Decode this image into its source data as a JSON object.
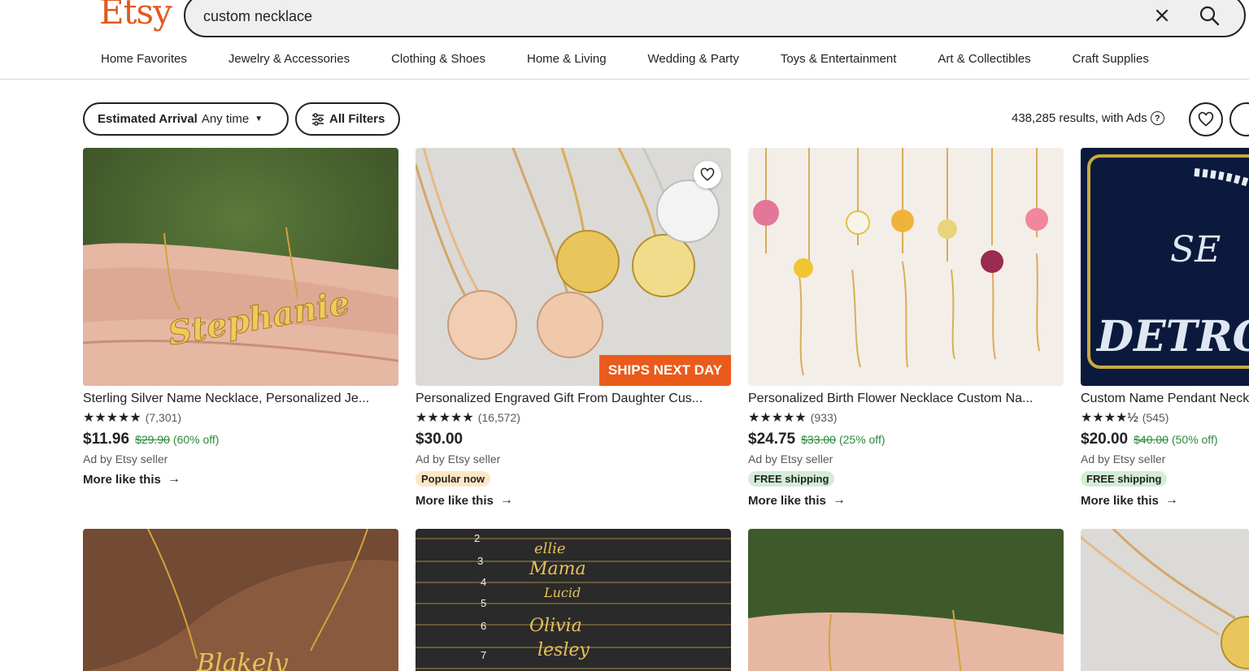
{
  "header": {
    "logo": "Etsy",
    "search_value": "custom necklace",
    "categories": [
      "Home Favorites",
      "Jewelry & Accessories",
      "Clothing & Shoes",
      "Home & Living",
      "Wedding & Party",
      "Toys & Entertainment",
      "Art & Collectibles",
      "Craft Supplies"
    ]
  },
  "filters": {
    "arrival_label": "Estimated Arrival",
    "arrival_value": "Any time",
    "all_filters": "All Filters",
    "results": "438,285 results, with Ads",
    "help": "?"
  },
  "listings": [
    {
      "title": "Sterling Silver Name Necklace, Personalized Je...",
      "stars": "★★★★★",
      "reviews": "(7,301)",
      "price": "$11.96",
      "original_price": "$29.90",
      "discount": "(60% off)",
      "seller": "Ad by Etsy seller",
      "more": "More like this",
      "image_text": "Stephanie"
    },
    {
      "title": "Personalized Engraved Gift From Daughter Cus...",
      "stars": "★★★★★",
      "reviews": "(16,572)",
      "price": "$30.00",
      "seller": "Ad by Etsy seller",
      "badge": "Popular now",
      "more": "More like this",
      "ships_label": "SHIPS NEXT DAY"
    },
    {
      "title": "Personalized Birth Flower Necklace Custom Na...",
      "stars": "★★★★★",
      "reviews": "(933)",
      "price": "$24.75",
      "original_price": "$33.00",
      "discount": "(25% off)",
      "seller": "Ad by Etsy seller",
      "badge": "FREE shipping",
      "more": "More like this"
    },
    {
      "title": "Custom Name Pendant Necklace",
      "stars": "★★★★½",
      "reviews": "(545)",
      "price": "$20.00",
      "original_price": "$40.00",
      "discount": "(50% off)",
      "seller": "Ad by Etsy seller",
      "badge": "FREE shipping",
      "more": "More like this"
    }
  ],
  "row2": {
    "card1_text": "Blakely",
    "card2_lines": [
      "ellie",
      "Mama",
      "Lucid",
      "Olivia",
      "lesley"
    ],
    "card2_numbers": [
      "2",
      "3",
      "4",
      "5",
      "6",
      "7"
    ]
  },
  "colors": {
    "brand": "#e2591d",
    "discount": "#2a8a3a",
    "ships_badge": "#ea5b1b"
  }
}
